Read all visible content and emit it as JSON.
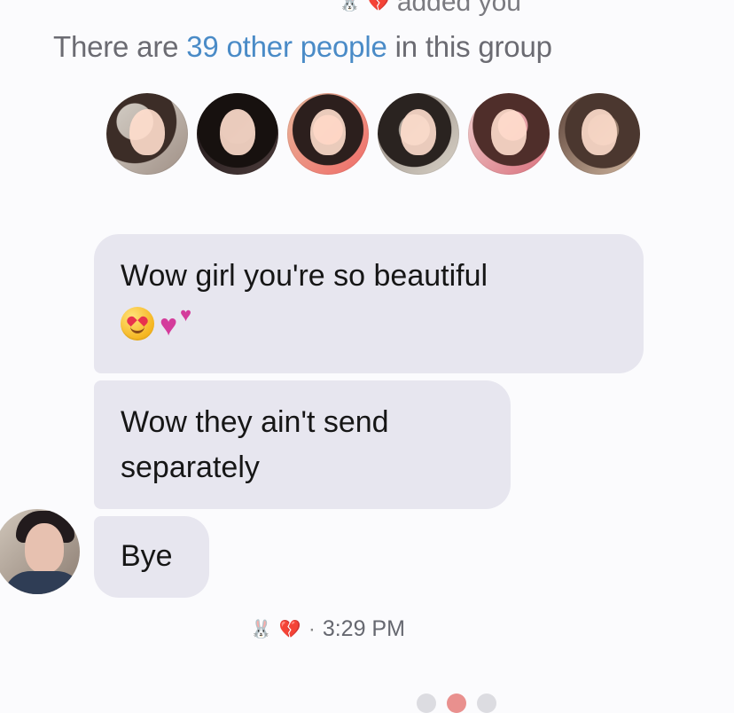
{
  "top_partial": {
    "text": "added you",
    "icon_1": "bunny-icon",
    "icon_2": "broken-heart-icon"
  },
  "group_info": {
    "prefix": "There are ",
    "link_text": "39 other people",
    "suffix": " in this group"
  },
  "messages": [
    {
      "text": "Wow girl you're so beautiful",
      "emojis": [
        "heart-eyes-emoji",
        "two-hearts-emoji"
      ]
    },
    {
      "text": "Wow they ain't send separately"
    },
    {
      "text": "Bye"
    }
  ],
  "seen": {
    "separator": "·",
    "time": "3:29 PM",
    "icons": [
      "bunny-icon",
      "broken-heart-icon"
    ]
  },
  "colors": {
    "background": "#fbfbfd",
    "bubble": "#e7e6ef",
    "link": "#4a8bc7",
    "muted_text": "#6b6b72",
    "heart": "#c9273b"
  }
}
